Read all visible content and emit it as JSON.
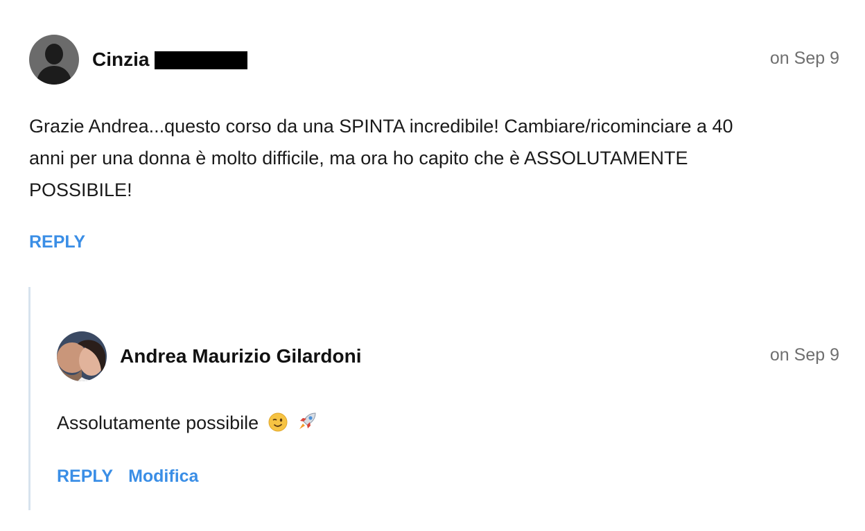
{
  "comments": [
    {
      "author": "Cinzia",
      "author_redacted": true,
      "date": "on Sep 9",
      "avatar": "default-user-silhouette",
      "body_lines": [
        "Grazie Andrea...questo corso da una SPINTA incredibile! Cambiare/ricominciare a 40",
        "anni per una donna è molto difficile, ma ora ho capito che è ASSOLUTAMENTE",
        "POSSIBILE!"
      ],
      "actions": [
        "REPLY"
      ]
    }
  ],
  "reply": {
    "author": "Andrea Maurizio Gilardoni",
    "date": "on Sep 9",
    "avatar": "user-photo",
    "body": "Assolutamente possibile",
    "emojis": [
      "winking-face-icon",
      "rocket-icon"
    ],
    "actions": [
      "REPLY",
      "Modifica"
    ]
  },
  "colors": {
    "link": "#3a8ee6",
    "date": "#6f6f6f",
    "thread_rule": "#d7e3ee"
  }
}
